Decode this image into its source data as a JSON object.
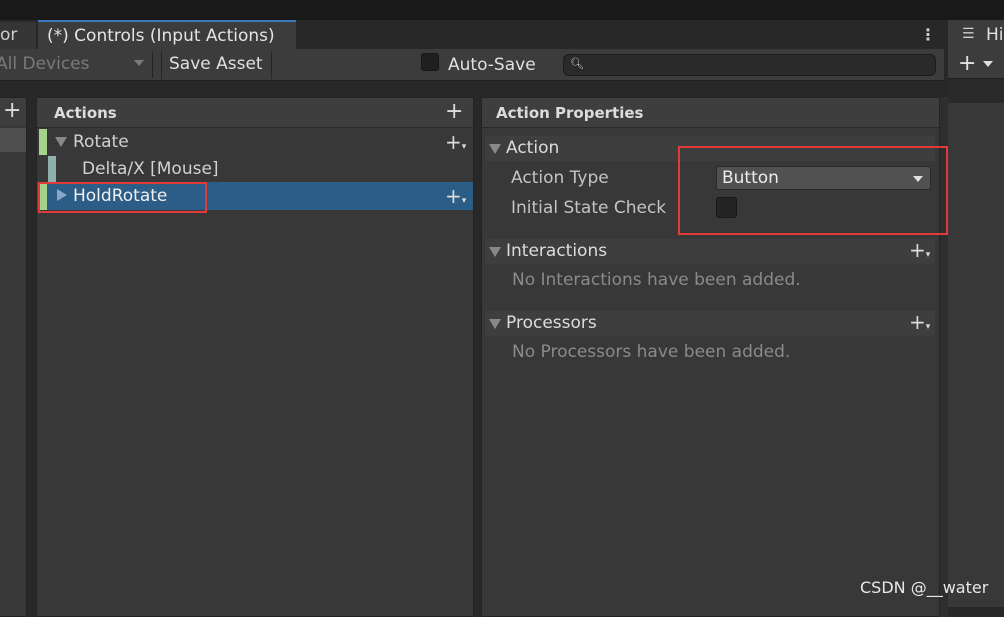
{
  "window": {
    "prev_tab_label": "or",
    "active_tab_label": "(*) Controls (Input Actions)"
  },
  "toolbar": {
    "devices_label": "All Devices",
    "save_label": "Save Asset",
    "autosave_label": "Auto-Save",
    "autosave_checked": false,
    "search_value": ""
  },
  "actions": {
    "header": "Actions",
    "items": [
      {
        "label": "Rotate",
        "expanded": true,
        "color": "#a5d38c"
      },
      {
        "label": "Delta/X [Mouse]",
        "color": "#8fb0ac"
      },
      {
        "label": "HoldRotate",
        "expanded": false,
        "selected": true,
        "color": "#a5d38c"
      }
    ]
  },
  "properties": {
    "header": "Action Properties",
    "action_section": "Action",
    "action_type_label": "Action Type",
    "action_type_value": "Button",
    "initial_state_label": "Initial State Check",
    "initial_state_checked": false,
    "interactions_section": "Interactions",
    "interactions_empty": "No Interactions have been added.",
    "processors_section": "Processors",
    "processors_empty": "No Processors have been added."
  },
  "hierarchy": {
    "tab_label": "Hi",
    "icon": "hierarchy-list-icon"
  },
  "watermark": "CSDN @__water",
  "colors": {
    "selection": "#2c5d87",
    "highlight_box": "#e03a3a",
    "active_tab_accent": "#3a79bb"
  }
}
